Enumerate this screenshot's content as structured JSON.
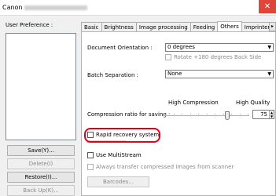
{
  "window": {
    "title_prefix": "Canon"
  },
  "sidebar": {
    "user_preference_label": "User Preference :",
    "buttons": [
      {
        "label": "Save(Y)...",
        "disabled": false
      },
      {
        "label": "Delete(I)",
        "disabled": true
      },
      {
        "label": "Restore(I)...",
        "disabled": false
      },
      {
        "label": "Back Up(K)...",
        "disabled": true
      }
    ]
  },
  "tabs": [
    "Basic",
    "Brightness",
    "Image processing",
    "Feeding",
    "Others",
    "Imprinter/Addo"
  ],
  "active_tab": "Others",
  "others": {
    "orientation_label": "Document Orientation :",
    "orientation_value": "0 degrees",
    "rotate_label": "Rotate +180 degrees Back Side",
    "batch_label": "Batch Separation :",
    "batch_value": "None",
    "high_compression": "High Compression",
    "high_quality": "High Quality",
    "compression_label": "Compression ratio for saving :",
    "compression_value": "75",
    "compression_level": 75,
    "rapid_recovery": "Rapid recovery system",
    "multistream": "Use MultiStream",
    "always_transfer": "Always transfer compressed images from scanner",
    "barcodes": "Barcodes..."
  },
  "colors": {
    "highlight": "#e1001a",
    "close": "#e0453a"
  }
}
